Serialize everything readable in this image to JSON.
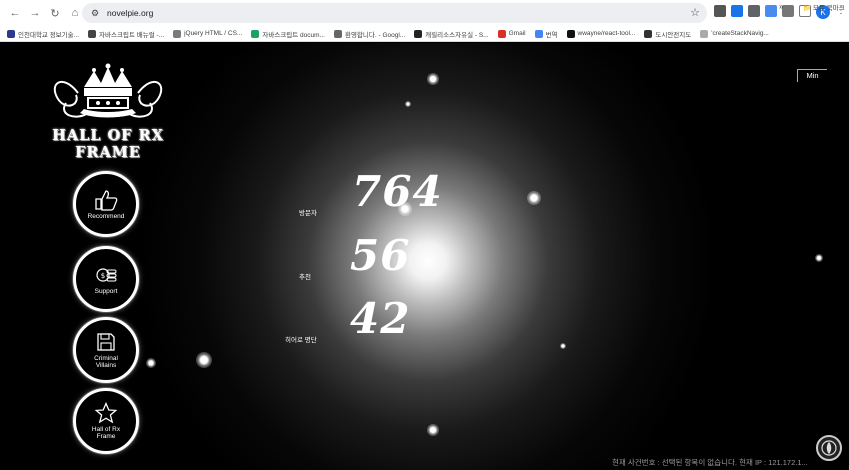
{
  "browser": {
    "url": "novelpie.org",
    "bookmarks": [
      {
        "label": "인천대학교 정보기술...",
        "color": "#2b3a8f"
      },
      {
        "label": "자바스크립트 배뉴럴 -...",
        "color": "#444444"
      },
      {
        "label": "jQuery HTML / CS...",
        "color": "#7a7a7a"
      },
      {
        "label": "자바스크립트 docum...",
        "color": "#1aa260"
      },
      {
        "label": "환영합니다. - Googl...",
        "color": "#666666"
      },
      {
        "label": "캐릴리소스자유실 - S...",
        "color": "#222222"
      },
      {
        "label": "Gmail",
        "color": "#d93025"
      },
      {
        "label": "번역",
        "color": "#4285f4"
      },
      {
        "label": "wwayne/react-tool...",
        "color": "#111111"
      },
      {
        "label": "도시안전지도",
        "color": "#333333"
      },
      {
        "label": "'createStackNavig...",
        "color": "#aaaaaa"
      }
    ],
    "bookmarks_folder": "모든 북마크",
    "profile_initial": "K"
  },
  "page": {
    "logo_title": "HALL OF RX FRAME",
    "min_button": "Min",
    "nav": [
      {
        "label": "Recommend",
        "icon": "thumbs-up-icon"
      },
      {
        "label": "Support",
        "icon": "coins-icon"
      },
      {
        "label": "Criminal\nVillains",
        "icon": "floppy-disk-icon"
      },
      {
        "label": "Hall of Rx\nFrame",
        "icon": "star-icon"
      }
    ],
    "stats": [
      {
        "label": "방문자",
        "value": "764"
      },
      {
        "label": "추천",
        "value": "56"
      },
      {
        "label": "히어로 명단",
        "value": "42"
      }
    ],
    "status_line": "현재 사건번호 : 선택된 항목이 없습니다. 현재 IP : 121.172.1..."
  }
}
